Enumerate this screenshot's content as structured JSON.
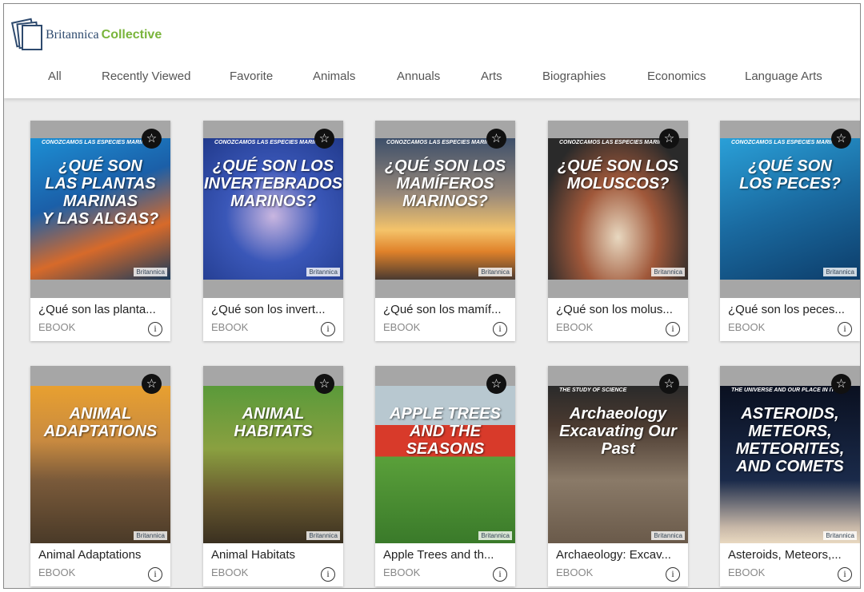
{
  "logo": {
    "brand": "Britannica",
    "product": "Collective"
  },
  "nav": [
    "All",
    "Recently Viewed",
    "Favorite",
    "Animals",
    "Annuals",
    "Arts",
    "Biographies",
    "Economics",
    "Language Arts"
  ],
  "books": [
    {
      "title": "¿Qué son las planta...",
      "type": "EBOOK",
      "cover": "¿QUÉ SON\nLAS PLANTAS\nMARINAS\nY LAS ALGAS?",
      "series": "CONOZCAMOS LAS ESPECIES MARINAS",
      "pub": "Britannica",
      "bg": "linear-gradient(160deg,#1c8fd4,#1b5fa8 40%,#d76a2a 70%,#1a3b5c)"
    },
    {
      "title": "¿Qué son los invert...",
      "type": "EBOOK",
      "cover": "¿QUÉ SON LOS\nINVERTEBRADOS\nMARINOS?",
      "series": "CONOZCAMOS LAS ESPECIES MARINAS",
      "pub": "Britannica",
      "bg": "radial-gradient(circle at 50% 55%,#c9b6e0,#3a57b8 45%,#213a8c)"
    },
    {
      "title": "¿Qué son los mamíf...",
      "type": "EBOOK",
      "cover": "¿QUÉ SON LOS\nMAMÍFEROS\nMARINOS?",
      "series": "CONOZCAMOS LAS ESPECIES MARINAS",
      "pub": "Britannica",
      "bg": "linear-gradient(180deg,#3d4f6a,#9a8a7a 40%,#f4c36a 65%,#e0822a 80%,#4a3a30)"
    },
    {
      "title": "¿Qué son los molus...",
      "type": "EBOOK",
      "cover": "¿QUÉ SON LOS\nMOLUSCOS?",
      "series": "CONOZCAMOS LAS ESPECIES MARINAS",
      "pub": "Britannica",
      "bg": "radial-gradient(ellipse at 50% 70%,#e8d8c0,#a0583a 40%,#2a2a2a 80%)"
    },
    {
      "title": "¿Qué son los peces...",
      "type": "EBOOK",
      "cover": "¿QUÉ SON\nLOS PECES?",
      "series": "CONOZCAMOS LAS ESPECIES MARINAS",
      "pub": "Britannica",
      "bg": "linear-gradient(160deg,#2aa0d8,#1a6aa0 50%,#0d3d6a)"
    },
    {
      "title": "Animal Adaptations",
      "type": "EBOOK",
      "cover": "ANIMAL\nADAPTATIONS",
      "series": "",
      "pub": "Britannica",
      "bg": "linear-gradient(180deg,#e8a030,#c88a40 35%,#7a5a3a 60%,#4a3a28)"
    },
    {
      "title": "Animal Habitats",
      "type": "EBOOK",
      "cover": "ANIMAL\nHABITATS",
      "series": "",
      "pub": "Britannica",
      "bg": "linear-gradient(180deg,#5a9a3a,#8aa040 40%,#6a5a30 70%,#3a3020)"
    },
    {
      "title": "Apple Trees and th...",
      "type": "EBOOK",
      "cover": "APPLE TREES\nAND THE SEASONS",
      "series": "",
      "pub": "Britannica",
      "bg": "linear-gradient(180deg,#b8c8d0 0%,#b8c8d0 25%,#d83a2a 25%,#d83a2a 45%,#5aa03a 45%,#3a7a2a)"
    },
    {
      "title": "Archaeology: Excav...",
      "type": "EBOOK",
      "cover": "Archaeology\nExcavating Our Past",
      "series": "THE STUDY OF SCIENCE",
      "pub": "Britannica",
      "bg": "linear-gradient(180deg,#2a2a2a,#4a3a30 25%,#8a7a68 60%,#6a5a4a)"
    },
    {
      "title": "Asteroids, Meteors,...",
      "type": "EBOOK",
      "cover": "ASTEROIDS,\nMETEORS,\nMETEORITES,\nAND COMETS",
      "series": "THE UNIVERSE AND OUR PLACE IN IT",
      "pub": "Britannica",
      "bg": "linear-gradient(180deg,#0a1020,#1a2a4a 60%,#c8b8a8 90%,#e8d8c0)"
    }
  ],
  "icons": {
    "favorite": "star-icon",
    "info": "info-icon"
  }
}
